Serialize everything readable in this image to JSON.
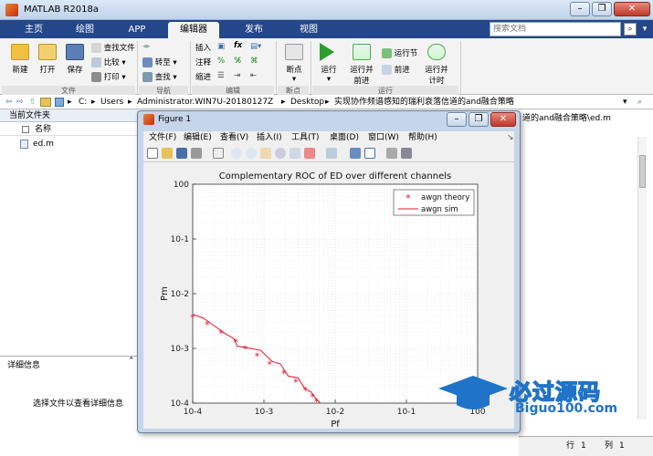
{
  "window": {
    "title": "MATLAB R2018a",
    "min": "–",
    "max": "❐",
    "close": "✕"
  },
  "tabs": [
    "主页",
    "绘图",
    "APP",
    "编辑器",
    "发布",
    "视图"
  ],
  "active_tab": "编辑器",
  "search": {
    "placeholder": "搜索文档"
  },
  "ribbon": {
    "file": {
      "new": "新建",
      "open": "打开",
      "save": "保存",
      "find_files": "查找文件",
      "compare": "比较",
      "print": "打印",
      "group": "文件"
    },
    "nav": {
      "goto": "转至",
      "find": "查找",
      "group": "导航"
    },
    "edit": {
      "insert": "插入",
      "comment": "注释",
      "indent": "缩进",
      "fx": "fx",
      "group": "编辑"
    },
    "breakpoint": {
      "label": "断点",
      "group": "断点"
    },
    "run": {
      "run": "运行",
      "run_advance": "运行并\n前进",
      "run_section": "运行节",
      "advance": "前进",
      "run_time": "运行并\n计时",
      "group": "运行"
    }
  },
  "address": {
    "path": [
      "C:",
      "Users",
      "Administrator.WIN7U-20180127Z",
      "Desktop",
      "实现协作频谱感知的瑞利衰落信道的and融合策略"
    ],
    "path_sep": "▸",
    "right_path": "道的and融合策略\\ed.m"
  },
  "current_folder": {
    "header": "当前文件夹",
    "col_name": "名称",
    "files": [
      "ed.m"
    ]
  },
  "details": {
    "header": "详细信息",
    "text": "选择文件以查看详细信息"
  },
  "statusbar": {
    "row_label": "行",
    "row": "1",
    "col_label": "列",
    "col": "1"
  },
  "figure": {
    "title": "Figure 1",
    "menu": [
      "文件(F)",
      "编辑(E)",
      "查看(V)",
      "插入(I)",
      "工具(T)",
      "桌面(D)",
      "窗口(W)",
      "帮助(H)"
    ]
  },
  "chart_data": {
    "type": "line",
    "title": "Complementary ROC of ED over different channels",
    "xlabel": "Pf",
    "ylabel": "Pm",
    "xscale": "log",
    "yscale": "log",
    "xlim": [
      0.0001,
      1
    ],
    "ylim": [
      0.0001,
      1
    ],
    "x_ticks": [
      "10-4",
      "10-3",
      "10-2",
      "10-1",
      "100"
    ],
    "y_ticks": [
      "100",
      "10-1",
      "10-2",
      "10-3",
      "10-4"
    ],
    "grid": true,
    "legend_position": "top-right",
    "series": [
      {
        "name": "awgn theory",
        "style": "red star markers",
        "x": [
          0.0001,
          0.00016,
          0.00025,
          0.0004,
          0.00055,
          0.0008,
          0.0012,
          0.0019,
          0.0028,
          0.0038,
          0.0048,
          0.0055
        ],
        "y": [
          0.0037,
          0.0027,
          0.0019,
          0.0013,
          0.00099,
          0.00072,
          0.00051,
          0.00035,
          0.00024,
          0.00017,
          0.00013,
          0.000105
        ]
      },
      {
        "name": "awgn sim",
        "style": "red solid line",
        "x": [
          0.0001,
          0.00014,
          0.0002,
          0.00028,
          0.00038,
          0.00042,
          0.00065,
          0.0009,
          0.0013,
          0.0017,
          0.0022,
          0.003,
          0.0038,
          0.0046,
          0.0055,
          0.0062
        ],
        "y": [
          0.0042,
          0.0036,
          0.0026,
          0.0019,
          0.0015,
          0.0011,
          0.001,
          0.00092,
          0.00058,
          0.00052,
          0.00031,
          0.00029,
          0.00018,
          0.00016,
          0.000115,
          0.0001
        ]
      }
    ]
  },
  "watermark": {
    "brand": "必过源码",
    "url": "Biguo100.com"
  },
  "colors": {
    "titlebar": "#c9dbef",
    "tabstrip": "#24468a",
    "series": "#e8102a",
    "figure_bg": "#c5d5ea"
  }
}
